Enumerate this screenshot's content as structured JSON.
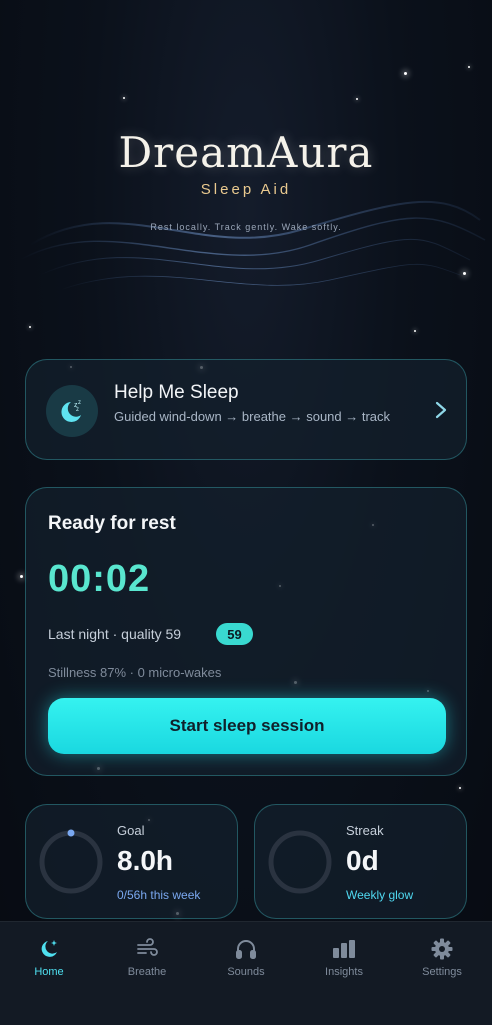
{
  "brand": {
    "title": "DreamAura",
    "subtitle": "Sleep Aid",
    "tagline": "Rest locally. Track gently. Wake softly."
  },
  "help_card": {
    "title": "Help Me Sleep",
    "description": "Guided wind-down → breathe → sound → track",
    "icon": "moon-zzz-icon"
  },
  "rest_card": {
    "title": "Ready for rest",
    "timer": "00:02",
    "last_night": "Last night · quality 59",
    "quality_badge": "59",
    "quality_score": 59,
    "stillness": "Stillness 87% · 0 micro-wakes",
    "start_button": "Start sleep session"
  },
  "goal_card": {
    "label": "Goal",
    "value": "8.0h",
    "sub": "0/56h this week",
    "progress": 0.0
  },
  "streak_card": {
    "label": "Streak",
    "value": "0d",
    "sub": "Weekly glow"
  },
  "nav": {
    "items": [
      {
        "label": "Home",
        "icon": "moon-star-icon",
        "active": true
      },
      {
        "label": "Breathe",
        "icon": "wind-icon",
        "active": false
      },
      {
        "label": "Sounds",
        "icon": "headphones-icon",
        "active": false
      },
      {
        "label": "Insights",
        "icon": "bar-chart-icon",
        "active": false
      },
      {
        "label": "Settings",
        "icon": "gear-icon",
        "active": false
      }
    ]
  },
  "colors": {
    "accent": "#39e6e6",
    "timer": "#59e6cf",
    "brand_gold": "#e9c98f",
    "goal_sub": "#7aa8f0",
    "streak_sub": "#4fd8f0",
    "background": "#0b111b"
  }
}
